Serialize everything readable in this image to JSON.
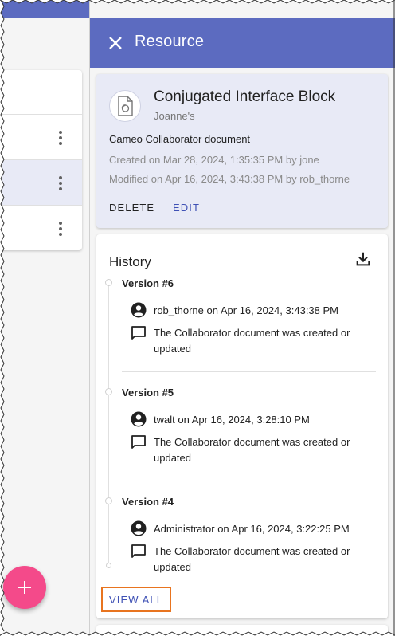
{
  "drawer": {
    "title": "Resource",
    "close_icon": "close-icon"
  },
  "resource": {
    "icon": "document-icon",
    "name": "Conjugated Interface Block",
    "owner": "Joanne's",
    "type": "Cameo Collaborator document",
    "created": "Created on Mar 28, 2024, 1:35:35 PM by jone",
    "modified": "Modified on Apr 16, 2024, 3:43:38 PM by rob_thorne",
    "actions": {
      "delete": "DELETE",
      "edit": "EDIT"
    },
    "card_color": "#e8eaf6",
    "edit_color": "#3f51b5"
  },
  "history": {
    "title": "History",
    "download_icon": "download-icon",
    "versions": [
      {
        "label": "Version #6",
        "user_line": "rob_thorne on Apr 16, 2024, 3:43:38 PM",
        "message": "The Collaborator document was created or updated"
      },
      {
        "label": "Version #5",
        "user_line": "twalt on Apr 16, 2024, 3:28:10 PM",
        "message": "The Collaborator document was created or updated"
      },
      {
        "label": "Version #4",
        "user_line": "Administrator on Apr 16, 2024, 3:22:25 PM",
        "message": "The Collaborator document was created or updated"
      }
    ],
    "view_all": "VIEW ALL",
    "highlight_color": "#e8741f"
  },
  "background": {
    "header_color": "#5c6bc0",
    "fab_color": "#f44a8a",
    "fab_icon": "plus-icon",
    "list_menu_icon": "more-vert-icon",
    "selected_row_color": "#e8eaf6"
  }
}
